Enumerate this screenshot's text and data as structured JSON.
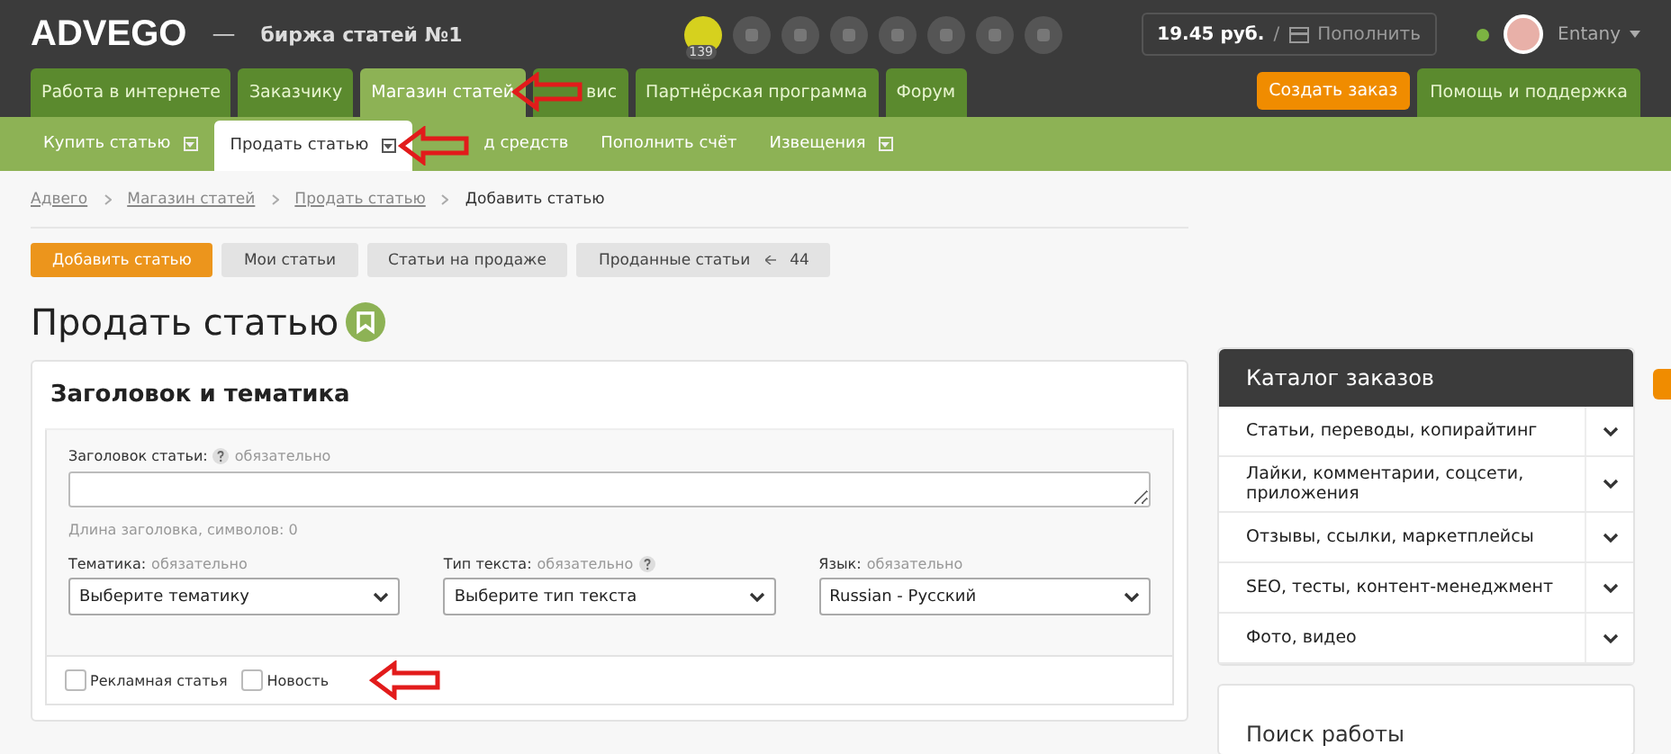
{
  "header": {
    "logo": "ADVEGO",
    "dash": "—",
    "tagline": "биржа статей №1",
    "notification_count": "139",
    "balance": "19.45 руб.",
    "separator": "/",
    "topup": "Пополнить",
    "online": true,
    "username": "Entany"
  },
  "main_tabs": [
    {
      "label": "Работа в интернете",
      "selected": false
    },
    {
      "label": "Заказчику",
      "selected": false
    },
    {
      "label": "Магазин статей",
      "selected": true
    },
    {
      "label": "вис",
      "selected": false
    },
    {
      "label": "Партнёрская программа",
      "selected": false
    },
    {
      "label": "Форум",
      "selected": false
    }
  ],
  "create_order": "Создать заказ",
  "help_tab": "Помощь и поддержка",
  "sub_tabs": [
    {
      "label": "Купить статью",
      "selected": false,
      "dropdown": true
    },
    {
      "label": "Продать статью",
      "selected": true,
      "dropdown": true
    },
    {
      "label": "д средств",
      "selected": false,
      "dropdown": false
    },
    {
      "label": "Пополнить счёт",
      "selected": false,
      "dropdown": false
    },
    {
      "label": "Извещения",
      "selected": false,
      "dropdown": true
    }
  ],
  "breadcrumbs": [
    {
      "label": "Адвего",
      "link": true
    },
    {
      "label": "Магазин статей",
      "link": true
    },
    {
      "label": "Продать статью",
      "link": true
    },
    {
      "label": "Добавить статью",
      "link": false
    }
  ],
  "actions": [
    {
      "label": "Добавить статью",
      "selected": true
    },
    {
      "label": "Мои статьи",
      "selected": false
    },
    {
      "label": "Статьи на продаже",
      "selected": false
    },
    {
      "label": "Проданные статьи",
      "selected": false,
      "count": "44"
    }
  ],
  "page_title": "Продать статью",
  "form": {
    "section_title": "Заголовок и тематика",
    "title_label": "Заголовок статьи:",
    "title_required": "обязательно",
    "title_length": "Длина заголовка, символов: 0",
    "selects": [
      {
        "label": "Тематика:",
        "required": "обязательно",
        "help": false,
        "value": "Выберите тематику"
      },
      {
        "label": "Тип текста:",
        "required": "обязательно",
        "help": true,
        "value": "Выберите тип текста"
      },
      {
        "label": "Язык:",
        "required": "обязательно",
        "help": false,
        "value": "Russian - Русский"
      }
    ],
    "checkboxes": [
      {
        "label": "Рекламная статья",
        "checked": false
      },
      {
        "label": "Новость",
        "checked": false
      }
    ]
  },
  "catalog": {
    "title": "Каталог заказов",
    "items": [
      "Статьи, переводы, копирайтинг",
      "Лайки, комментарии, соцсети, приложения",
      "Отзывы, ссылки, маркетплейсы",
      "SEO, тесты, контент-менеджмент",
      "Фото, видео"
    ]
  },
  "job_search": {
    "title": "Поиск работы"
  }
}
